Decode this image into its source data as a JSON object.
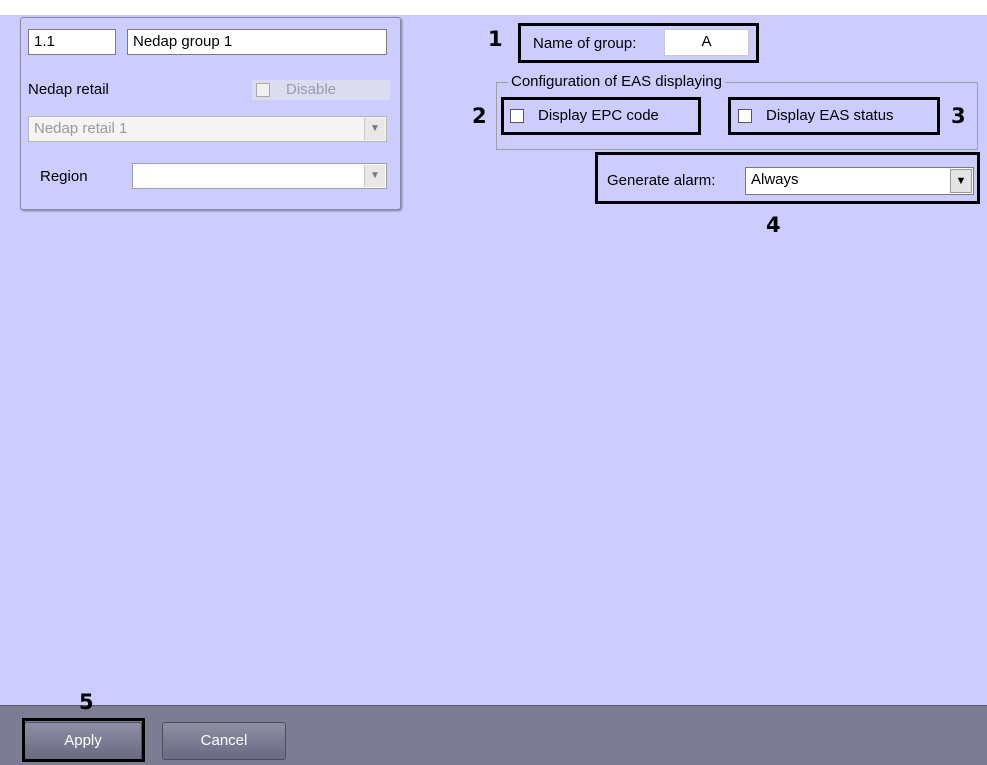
{
  "object": {
    "id": "1.1",
    "name": "Nedap group 1",
    "parent_label": "Nedap retail",
    "disable_label": "Disable",
    "parent_value": "Nedap retail 1",
    "region_label": "Region",
    "region_value": ""
  },
  "settings": {
    "group_name_label": "Name of group:",
    "group_name_value": "A",
    "eas_group_title": "Configuration of EAS displaying",
    "display_epc_label": "Display EPC code",
    "display_eas_label": "Display EAS status",
    "generate_alarm_label": "Generate alarm:",
    "generate_alarm_value": "Always"
  },
  "callouts": [
    "1",
    "2",
    "3",
    "4",
    "5"
  ],
  "footer": {
    "apply_label": "Apply",
    "cancel_label": "Cancel"
  },
  "icons": {
    "dropdown_arrow": "▼"
  },
  "colors": {
    "workspace": "#ccccff",
    "footer": "#7c7c92"
  }
}
